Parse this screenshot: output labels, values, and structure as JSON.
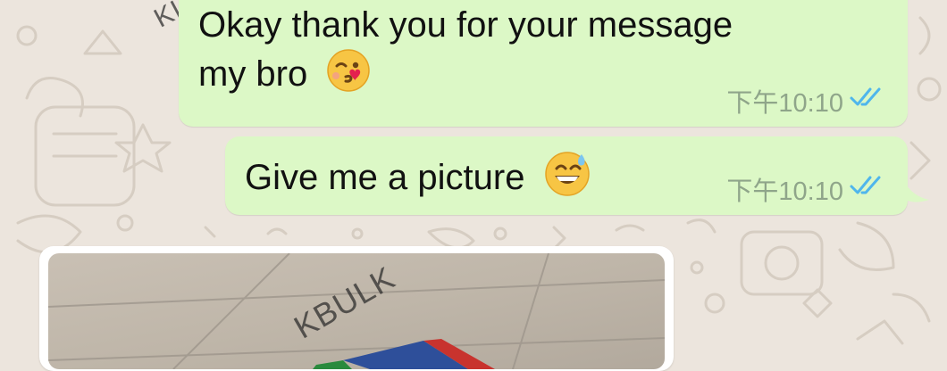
{
  "colors": {
    "wallpaper": "#ece5dd",
    "outgoing_bubble": "#dcf8c6",
    "read_ticks": "#4fb6ec",
    "timestamp": "#8fa58a"
  },
  "messages": [
    {
      "text_line1": "Okay thank you for your message",
      "text_line2": "my bro",
      "emoji": "face-blowing-a-kiss",
      "time": "下午10:10",
      "status": "read-double-check"
    },
    {
      "text": "Give me a picture",
      "emoji": "grinning-face-with-sweat",
      "time": "下午10:10",
      "status": "read-double-check"
    }
  ],
  "image_message": {
    "watermark_top": "KIC",
    "watermark_photo": "KBULK"
  }
}
